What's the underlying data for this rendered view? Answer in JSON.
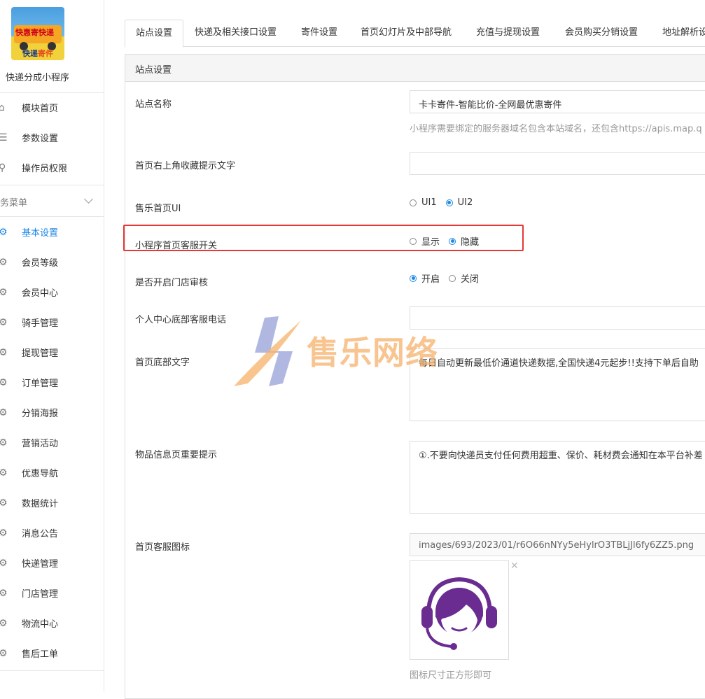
{
  "app": {
    "logo_line1": "快惠寄快递",
    "logo_brand_a": "快递",
    "logo_brand_b": "寄件",
    "name": "快递分成小程序"
  },
  "sidebar": {
    "top_items": [
      {
        "label": "模块首页",
        "icon": "home-icon"
      },
      {
        "label": "参数设置",
        "icon": "sliders-icon"
      },
      {
        "label": "操作员权限",
        "icon": "user-key-icon"
      }
    ],
    "group_label": "务菜单",
    "items": [
      {
        "label": "基本设置",
        "active": true
      },
      {
        "label": "会员等级"
      },
      {
        "label": "会员中心"
      },
      {
        "label": "骑手管理"
      },
      {
        "label": "提现管理"
      },
      {
        "label": "订单管理"
      },
      {
        "label": "分销海报"
      },
      {
        "label": "营销活动"
      },
      {
        "label": "优惠导航"
      },
      {
        "label": "数据统计"
      },
      {
        "label": "消息公告"
      },
      {
        "label": "快递管理"
      },
      {
        "label": "门店管理"
      },
      {
        "label": "物流中心"
      },
      {
        "label": "售后工单"
      }
    ]
  },
  "tabs": [
    "站点设置",
    "快递及相关接口设置",
    "寄件设置",
    "首页幻灯片及中部导航",
    "充值与提现设置",
    "会员购买分销设置",
    "地址解析设"
  ],
  "panel": {
    "title": "站点设置"
  },
  "form": {
    "site_name": {
      "label": "站点名称",
      "value": "卡卡寄件-智能比价-全网最优惠寄件",
      "hint": "小程序需要绑定的服务器域名包含本站域名，还包含https://apis.map.q"
    },
    "fav_tip": {
      "label": "首页右上角收藏提示文字",
      "value": ""
    },
    "ui": {
      "label": "售乐首页UI",
      "options": [
        "UI1",
        "UI2"
      ],
      "selected": 1
    },
    "service_switch": {
      "label": "小程序首页客服开关",
      "options": [
        "显示",
        "隐藏"
      ],
      "selected": 1
    },
    "store_review": {
      "label": "是否开启门店审核",
      "options": [
        "开启",
        "关闭"
      ],
      "selected": 0
    },
    "service_phone": {
      "label": "个人中心底部客服电话",
      "value": ""
    },
    "footer_text": {
      "label": "首页底部文字",
      "value": "每日自动更新最低价通道快递数据,全国快递4元起步!!支持下单后自助"
    },
    "item_tip": {
      "label": "物品信息页重要提示",
      "value": "①.不要向快递员支付任何费用超重、保价、耗材费会通知在本平台补差"
    },
    "service_icon": {
      "label": "首页客服图标",
      "value": "images/693/2023/01/r6O66nNYy5eHylrO3TBLjJl6fy6ZZ5.png",
      "hint": "图标尺寸正方形即可"
    }
  },
  "watermark": {
    "text": "售乐网络"
  },
  "colors": {
    "accent": "#1e88e5",
    "highlight": "#e53935",
    "purple": "#6a2c91"
  }
}
